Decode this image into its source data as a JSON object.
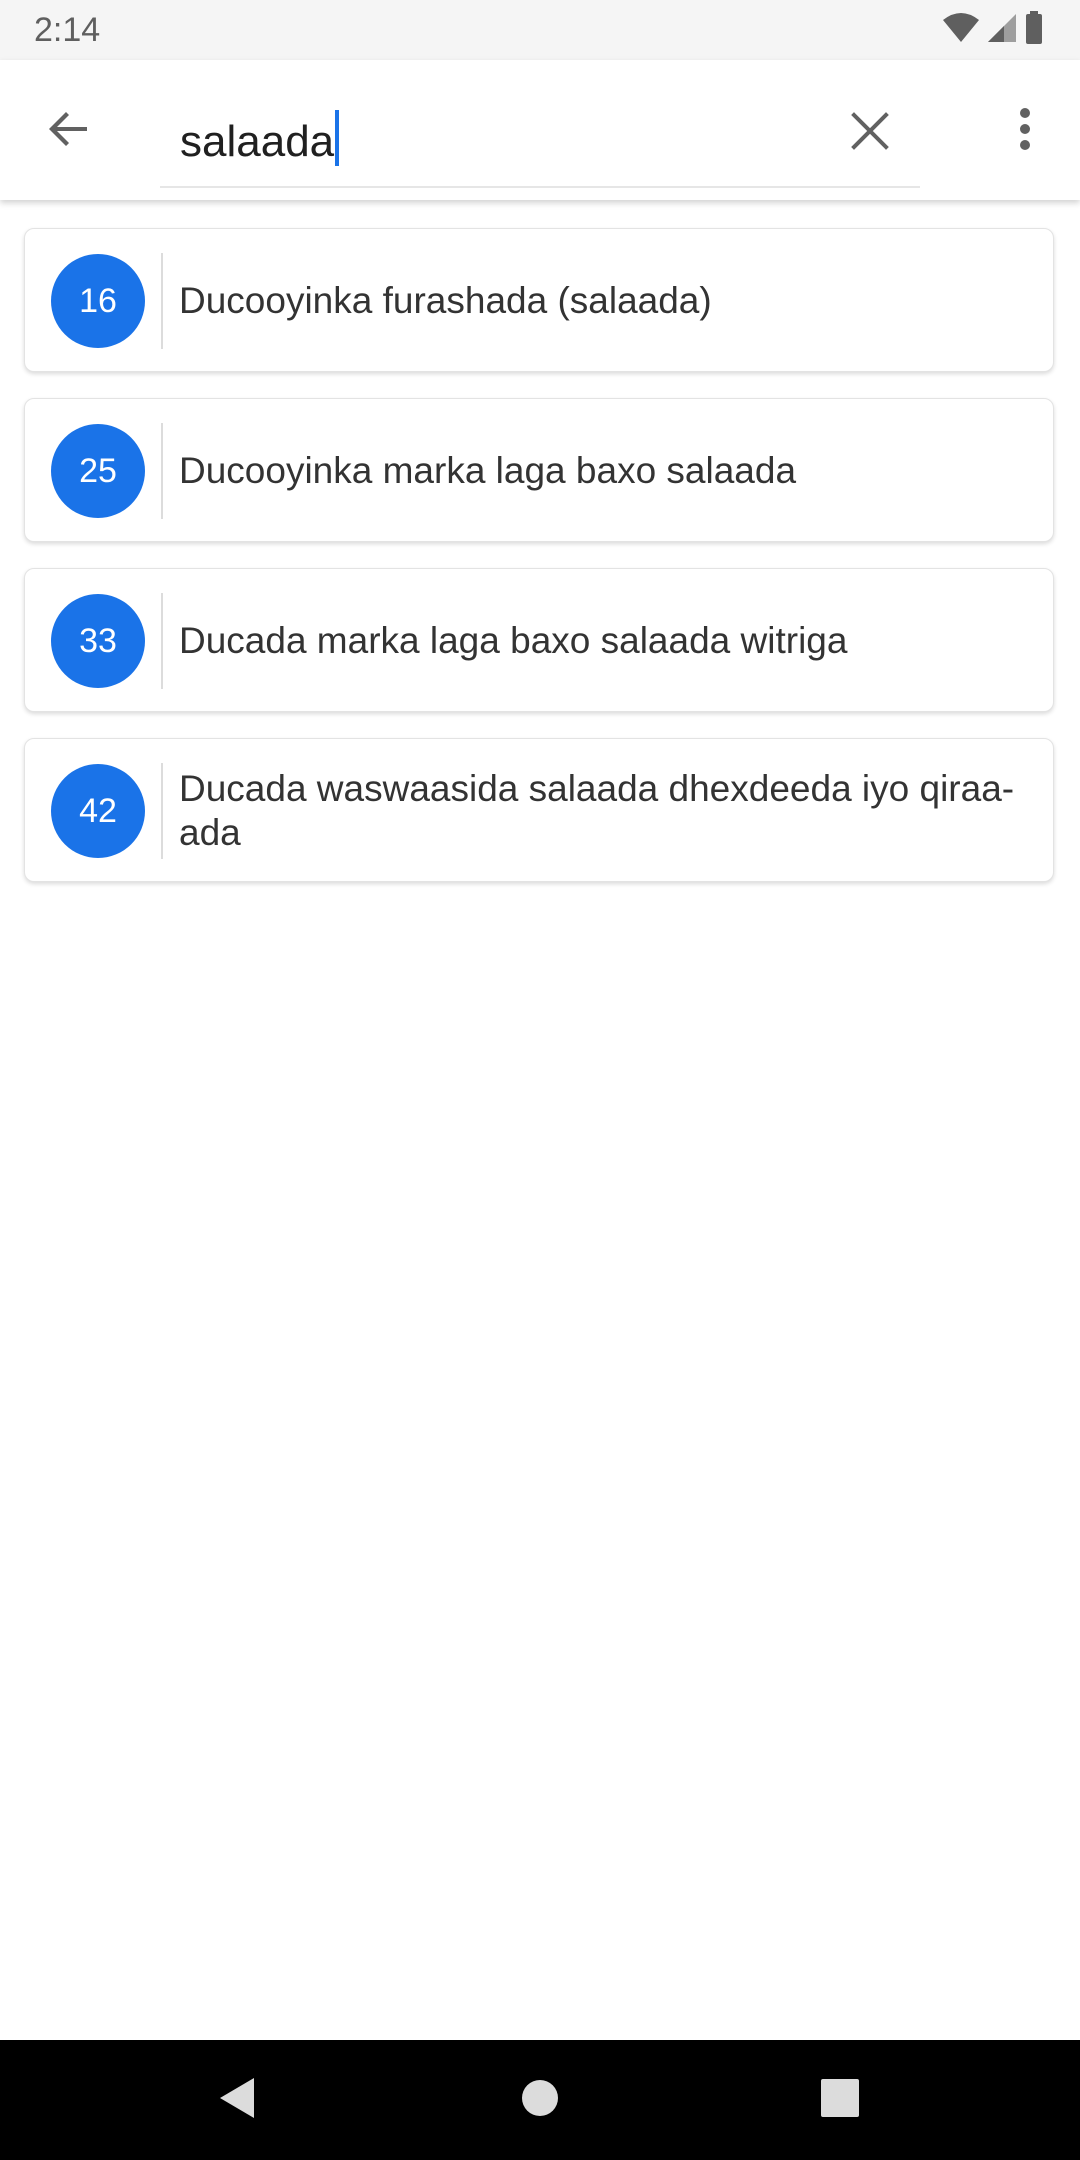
{
  "status_bar": {
    "time": "2:14"
  },
  "search": {
    "value": "salaada"
  },
  "results": [
    {
      "number": "16",
      "title": "Ducooyinka furashada (salaada)"
    },
    {
      "number": "25",
      "title": "Ducooyinka marka laga baxo salaada"
    },
    {
      "number": "33",
      "title": "Ducada marka laga baxo salaada witriga"
    },
    {
      "number": "42",
      "title": "Ducada waswaasida salaada dhexdeeda iyo qiraa-ada"
    }
  ],
  "colors": {
    "accent": "#1a73e8",
    "status_bar_bg": "#f5f5f5",
    "nav_bar_bg": "#000000",
    "text": "#333333"
  },
  "icons": {
    "back": "arrow-left-icon",
    "clear": "close-icon",
    "more": "more-vert-icon",
    "wifi": "wifi-icon",
    "signal": "signal-icon",
    "battery": "battery-icon",
    "nav_back": "nav-back-icon",
    "nav_home": "nav-home-icon",
    "nav_recents": "nav-recents-icon"
  }
}
